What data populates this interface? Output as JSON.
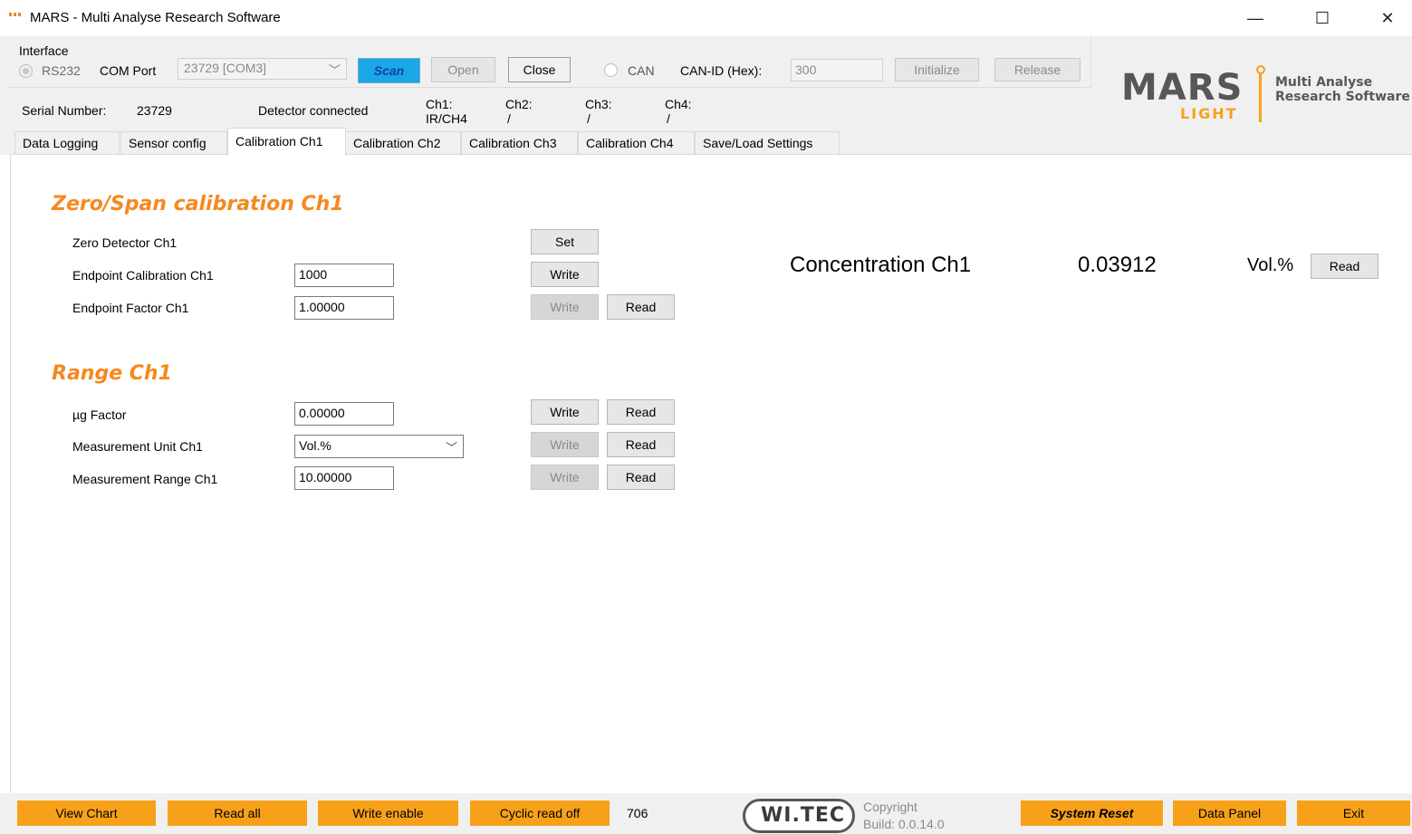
{
  "window": {
    "title": "MARS - Multi Analyse Research Software",
    "minimize": "—",
    "maximize": "☐",
    "close": "✕"
  },
  "interface": {
    "group_label": "Interface",
    "rs232_label": "RS232",
    "com_port_label": "COM Port",
    "com_port_value": "23729 [COM3]",
    "scan_label": "Scan",
    "open_label": "Open",
    "close_label": "Close",
    "can_label": "CAN",
    "can_id_label": "CAN-ID (Hex):",
    "can_id_value": "300",
    "initialize_label": "Initialize",
    "release_label": "Release"
  },
  "status": {
    "serial_label": "Serial Number:",
    "serial_value": "23729",
    "detector_status": "Detector connected",
    "ch1_label": "Ch1:",
    "ch1_value": "IR/CH4",
    "ch2_label": "Ch2:",
    "ch2_value": "/",
    "ch3_label": "Ch3:",
    "ch3_value": "/",
    "ch4_label": "Ch4:",
    "ch4_value": "/"
  },
  "logo": {
    "mars": "MARS",
    "light": "LIGHT",
    "line1": "Multi Analyse",
    "line2": "Research Software"
  },
  "tabs": [
    {
      "label": "Data Logging"
    },
    {
      "label": "Sensor config"
    },
    {
      "label": "Calibration Ch1"
    },
    {
      "label": "Calibration Ch2"
    },
    {
      "label": "Calibration Ch3"
    },
    {
      "label": "Calibration Ch4"
    },
    {
      "label": "Save/Load Settings"
    }
  ],
  "zero_span": {
    "title": "Zero/Span calibration Ch1",
    "zero_label": "Zero Detector Ch1",
    "set_label": "Set",
    "endpoint_cal_label": "Endpoint Calibration Ch1",
    "endpoint_cal_value": "1000",
    "endpoint_factor_label": "Endpoint Factor Ch1",
    "endpoint_factor_value": "1.00000",
    "write_label": "Write",
    "read_label": "Read"
  },
  "concentration": {
    "label": "Concentration Ch1",
    "value": "0.03912",
    "unit": "Vol.%",
    "read_label": "Read"
  },
  "range": {
    "title": "Range Ch1",
    "ug_factor_label": "µg Factor",
    "ug_factor_value": "0.00000",
    "unit_label": "Measurement Unit Ch1",
    "unit_value": "Vol.%",
    "range_label": "Measurement Range Ch1",
    "range_value": "10.00000",
    "write_label": "Write",
    "read_label": "Read"
  },
  "footer": {
    "view_chart": "View Chart",
    "read_all": "Read all",
    "write_enable": "Write enable",
    "cyclic_read": "Cyclic read off",
    "counter": "706",
    "wtec": "WI.TEC",
    "copyright": "Copyright",
    "build": "Build: 0.0.14.0",
    "system_reset": "System Reset",
    "data_panel": "Data Panel",
    "exit": "Exit"
  },
  "colors": {
    "accent_orange": "#f7a11a",
    "section_title": "#f5891f",
    "scan_button": "#19a7e6"
  }
}
